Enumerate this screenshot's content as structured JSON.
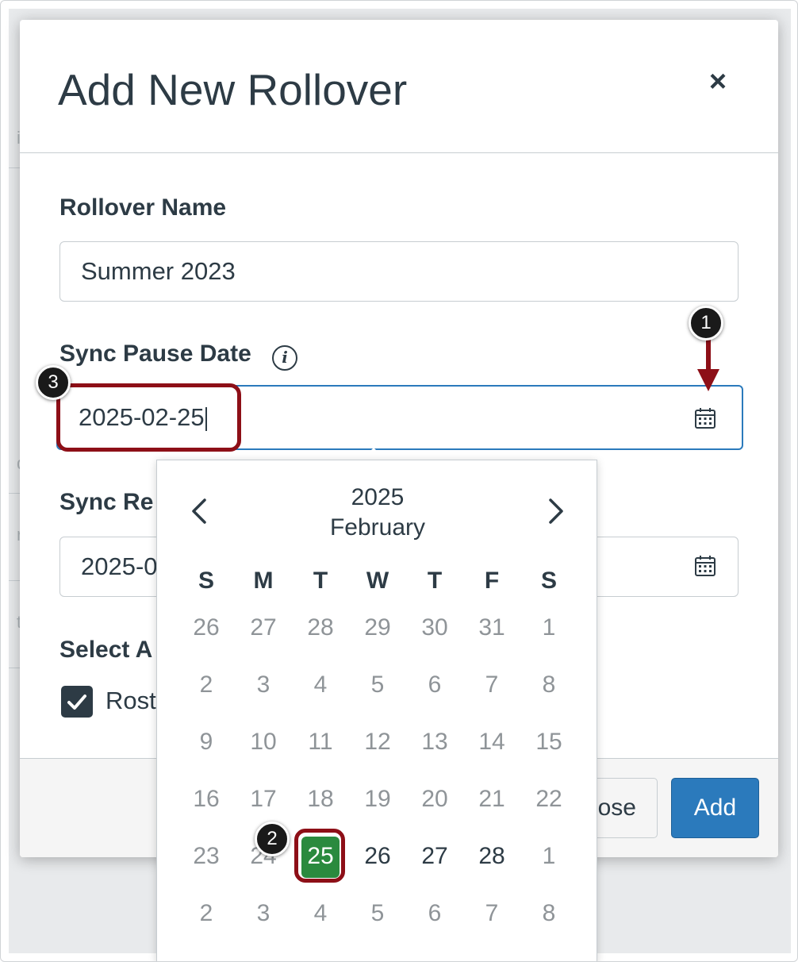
{
  "modal": {
    "title": "Add New Rollover",
    "close_glyph": "×"
  },
  "rollover_name": {
    "label": "Rollover Name",
    "value": "Summer 2023"
  },
  "sync_pause_date": {
    "label": "Sync Pause Date",
    "info_glyph": "i",
    "value": "2025-02-25"
  },
  "sync_resume_date": {
    "label_visible": "Sync Re",
    "value_visible": "2025-0"
  },
  "select_section": {
    "label_visible": "Select A",
    "checkbox_label_visible": "Rost",
    "checked": true
  },
  "footer": {
    "close_label_visible": "ose",
    "add_label": "Add"
  },
  "calendar": {
    "year": "2025",
    "month": "February",
    "weekdays": [
      "S",
      "M",
      "T",
      "W",
      "T",
      "F",
      "S"
    ],
    "weeks": [
      [
        "26",
        "27",
        "28",
        "29",
        "30",
        "31",
        "1"
      ],
      [
        "2",
        "3",
        "4",
        "5",
        "6",
        "7",
        "8"
      ],
      [
        "9",
        "10",
        "11",
        "12",
        "13",
        "14",
        "15"
      ],
      [
        "16",
        "17",
        "18",
        "19",
        "20",
        "21",
        "22"
      ],
      [
        "23",
        "24",
        "25",
        "26",
        "27",
        "28",
        "1"
      ],
      [
        "2",
        "3",
        "4",
        "5",
        "6",
        "7",
        "8"
      ]
    ],
    "selected_day": "25",
    "selected_color": "#2a8a3e"
  },
  "annotations": {
    "badges": [
      "1",
      "2",
      "3"
    ],
    "color": "#8d0f17"
  },
  "colors": {
    "primary": "#2b7abc",
    "text": "#2d3b45"
  },
  "icons": {
    "calendar": "calendar-icon",
    "prev": "chevron-left-icon",
    "next": "chevron-right-icon",
    "check": "checkmark-icon",
    "info": "info-icon",
    "close": "close-icon"
  }
}
